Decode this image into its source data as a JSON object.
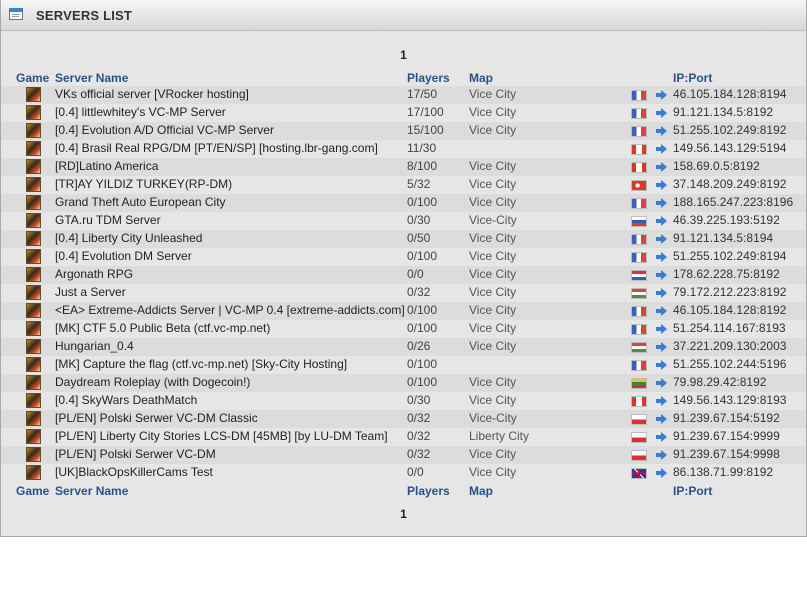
{
  "header": {
    "title": "SERVERS LIST"
  },
  "pager": {
    "top": "1",
    "bottom": "1"
  },
  "columns": {
    "game": "Game",
    "name": "Server Name",
    "players": "Players",
    "map": "Map",
    "ip": "IP:Port"
  },
  "servers": [
    {
      "name": "VKs official server [VRocker hosting]",
      "players": "17/50",
      "map": "Vice City",
      "flag": "fr",
      "ip": "46.105.184.128:8194"
    },
    {
      "name": "[0.4] littlewhitey's VC-MP Server",
      "players": "17/100",
      "map": "Vice City",
      "flag": "fr",
      "ip": "91.121.134.5:8192"
    },
    {
      "name": "[0.4] Evolution A/D Official VC-MP Server",
      "players": "15/100",
      "map": "Vice City",
      "flag": "fr",
      "ip": "51.255.102.249:8192"
    },
    {
      "name": "[0.4] Brasil Real RPG/DM [PT/EN/SP] [hosting.lbr-gang.com]",
      "players": "11/30",
      "map": "",
      "flag": "ca",
      "ip": "149.56.143.129:5194"
    },
    {
      "name": "[RD]Latino America",
      "players": "8/100",
      "map": "Vice City",
      "flag": "ca",
      "ip": "158.69.0.5:8192"
    },
    {
      "name": "[TR]AY YILDIZ TURKEY(RP-DM)",
      "players": "5/32",
      "map": "Vice City",
      "flag": "tr",
      "ip": "37.148.209.249:8192"
    },
    {
      "name": "Grand Theft Auto European City",
      "players": "0/100",
      "map": "Vice City",
      "flag": "fr",
      "ip": "188.165.247.223:8196"
    },
    {
      "name": "GTA.ru TDM Server",
      "players": "0/30",
      "map": "Vice-City",
      "flag": "ru",
      "ip": "46.39.225.193:5192"
    },
    {
      "name": "[0.4] Liberty City Unleashed",
      "players": "0/50",
      "map": "Vice City",
      "flag": "fr",
      "ip": "91.121.134.5:8194"
    },
    {
      "name": "[0.4] Evolution DM Server",
      "players": "0/100",
      "map": "Vice City",
      "flag": "fr",
      "ip": "51.255.102.249:8194"
    },
    {
      "name": "Argonath RPG",
      "players": "0/0",
      "map": "Vice City",
      "flag": "nl",
      "ip": "178.62.228.75:8192"
    },
    {
      "name": "Just a Server",
      "players": "0/32",
      "map": "Vice City",
      "flag": "hu",
      "ip": "79.172.212.223:8192"
    },
    {
      "name": "<EA> Extreme-Addicts Server | VC-MP 0.4 [extreme-addicts.com]",
      "players": "0/100",
      "map": "Vice City",
      "flag": "fr",
      "ip": "46.105.184.128:8192"
    },
    {
      "name": "[MK] CTF 5.0 Public Beta (ctf.vc-mp.net)",
      "players": "0/100",
      "map": "Vice City",
      "flag": "fr",
      "ip": "51.254.114.167:8193"
    },
    {
      "name": "Hungarian_0.4",
      "players": "0/26",
      "map": "Vice City",
      "flag": "hu",
      "ip": "37.221.209.130:2003"
    },
    {
      "name": "[MK] Capture the flag (ctf.vc-mp.net) [Sky-City Hosting]",
      "players": "0/100",
      "map": "",
      "flag": "fr",
      "ip": "51.255.102.244:5196"
    },
    {
      "name": "Daydream Roleplay (with Dogecoin!)",
      "players": "0/100",
      "map": "Vice City",
      "flag": "lt",
      "ip": "79.98.29.42:8192"
    },
    {
      "name": "[0.4] SkyWars DeathMatch",
      "players": "0/30",
      "map": "Vice City",
      "flag": "ca",
      "ip": "149.56.143.129:8193"
    },
    {
      "name": "[PL/EN] Polski Serwer VC-DM Classic",
      "players": "0/32",
      "map": "Vice-City",
      "flag": "pl",
      "ip": "91.239.67.154:5192"
    },
    {
      "name": "[PL/EN] Liberty City Stories LCS-DM [45MB] [by LU-DM Team]",
      "players": "0/32",
      "map": "Liberty City",
      "flag": "pl",
      "ip": "91.239.67.154:9999"
    },
    {
      "name": "[PL/EN] Polski Serwer VC-DM",
      "players": "0/32",
      "map": "Vice City",
      "flag": "pl",
      "ip": "91.239.67.154:9998"
    },
    {
      "name": "[UK]BlackOpsKillerCams Test",
      "players": "0/0",
      "map": "Vice City",
      "flag": "gb",
      "ip": "86.138.71.99:8192"
    }
  ],
  "colors": {
    "header_text": "#29528a",
    "row_alt": "#dcdcdc",
    "panel": "#e6e6e6",
    "arrow": "#3a7bd5"
  },
  "icons": {
    "header": "window-list-icon",
    "game": "game-icon",
    "connect": "arrow-right-icon"
  }
}
